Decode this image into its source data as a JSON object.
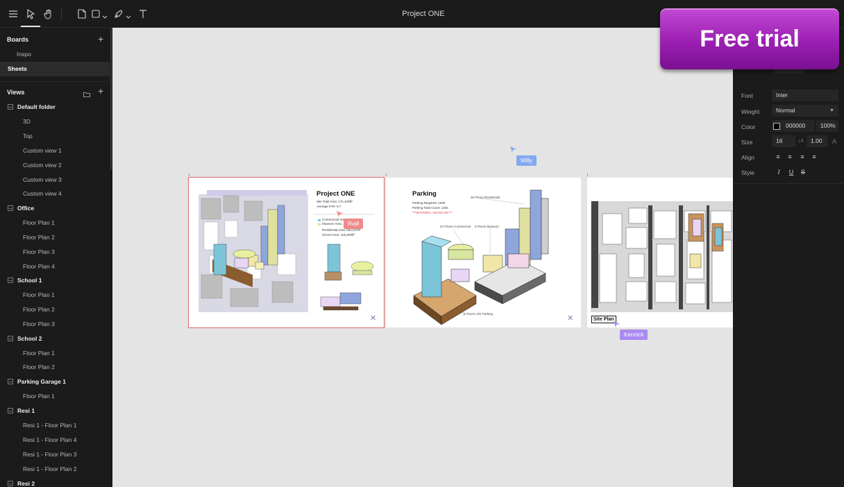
{
  "window": {
    "title": "Project ONE"
  },
  "toolbar": {
    "tools": [
      "menu-icon",
      "select-icon",
      "hand-icon",
      "page-icon",
      "shape-icon",
      "pen-icon",
      "text-icon"
    ]
  },
  "sidebar": {
    "boards_header": "Boards",
    "boards": [
      {
        "label": "Inspo",
        "selected": false
      },
      {
        "label": "Sheets",
        "selected": true
      }
    ],
    "views_header": "Views",
    "folders": [
      {
        "name": "Default folder",
        "items": [
          "3D",
          "Top",
          "Custom view 1",
          "Custom view 2",
          "Custom view 3",
          "Custom view 4"
        ]
      },
      {
        "name": "Office",
        "items": [
          "Floor Plan 1",
          "Floor Plan 2",
          "Floor Plan 3",
          "Floor Plan 4"
        ]
      },
      {
        "name": "School 1",
        "items": [
          "Floor Plan 1",
          "Floor Plan 2",
          "Floor Plan 3"
        ]
      },
      {
        "name": "School 2",
        "items": [
          "Floor Plan 1",
          "Floor Plan 2"
        ]
      },
      {
        "name": "Parking Garage 1",
        "items": [
          "Floor Plan 1"
        ]
      },
      {
        "name": "Resi 1",
        "items": [
          "Resi 1 - Floor Plan 1",
          "Resi 1 - Floor Plan 4",
          "Resi 1 - Floor Plan 3",
          "Resi 1 - Floor Plan 2"
        ]
      },
      {
        "name": "Resi 2",
        "items": []
      }
    ]
  },
  "canvas": {
    "sheet1": {
      "title": "Project ONE",
      "lines": [
        "Site Total Area: 171,340ft²",
        "Average FAR: 8.7"
      ],
      "legend": [
        "Commercial Area: ...",
        "Museum Area: ...",
        "Residential Area: 634,047ft²",
        "School Area: 126,600ft²"
      ]
    },
    "sheet2": {
      "title": "Parking",
      "lines": [
        "Parking Required: 1535",
        "Parking Total Count: 1464"
      ],
      "warning": "***WARNING: INCREASE***",
      "notes": [
        "26 Floors Residential",
        "24 Floors Commercial",
        "8 Floors Museum",
        "6 Floors U/G Parking"
      ]
    },
    "sheet3": {
      "label": "Site Plan"
    },
    "cursors": [
      {
        "name": "Rudi",
        "color": "#f08a8a"
      },
      {
        "name": "Willy",
        "color": "#84a8f0"
      },
      {
        "name": "Kennick",
        "color": "#a98af0"
      }
    ]
  },
  "properties": {
    "font_label": "Font",
    "font_value": "Inter",
    "weight_label": "Weight",
    "weight_value": "Normal",
    "color_label": "Color",
    "color_value": "000000",
    "opacity_value": "100%",
    "size_label": "Size",
    "size_value": "16",
    "line_height_value": "1.00",
    "align_label": "Align",
    "style_label": "Style"
  },
  "badge": {
    "label": "Free trial"
  },
  "colors": {
    "accent": "#a62bbd",
    "selection": "#e06666"
  }
}
